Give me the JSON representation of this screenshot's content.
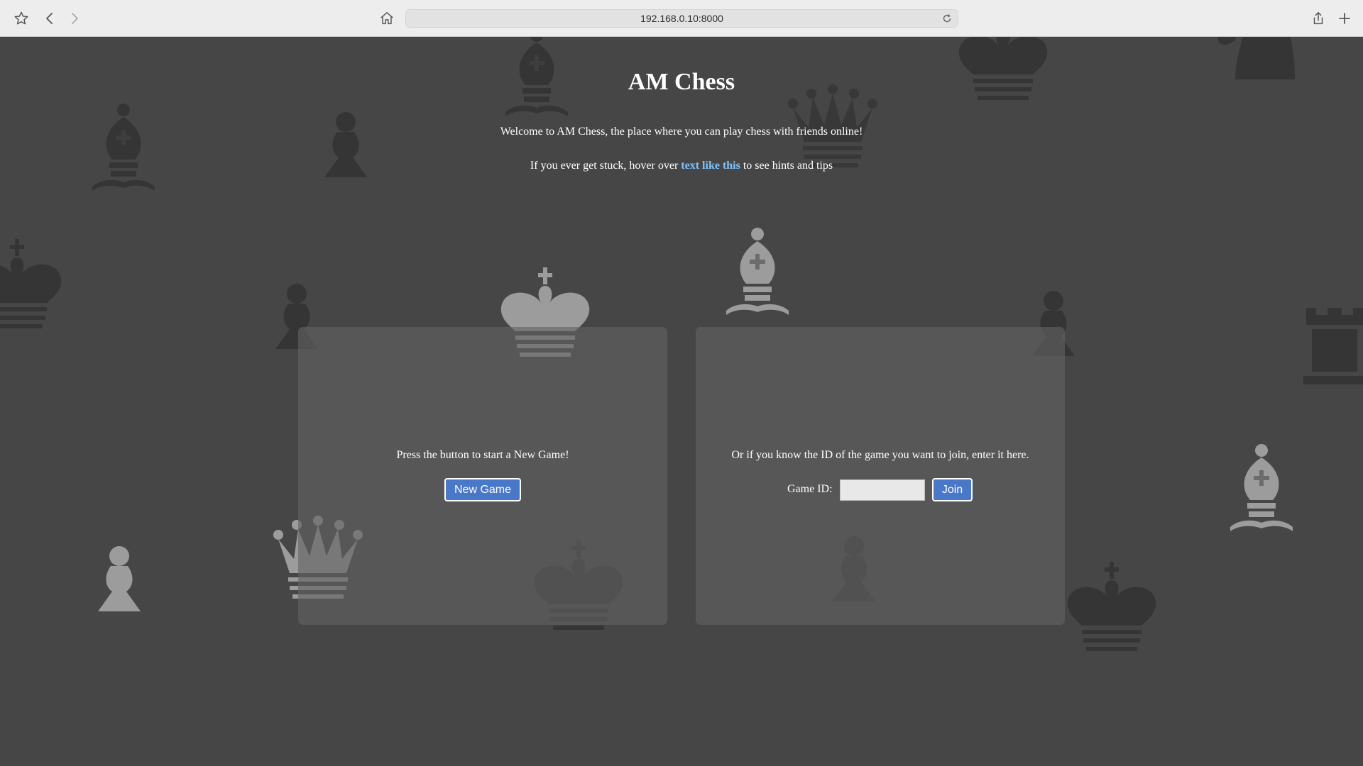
{
  "browser": {
    "url": "192.168.0.10:8000",
    "icons": [
      "bookmark-star-icon",
      "back-icon",
      "forward-icon",
      "home-icon",
      "reload-icon",
      "share-icon",
      "new-tab-icon"
    ]
  },
  "header": {
    "title": "AM Chess",
    "welcome": "Welcome to AM Chess, the place where you can play chess with friends online!",
    "hint_prefix": "If you ever get stuck, hover over ",
    "hint_link": "text like this",
    "hint_suffix": " to see hints and tips"
  },
  "new_game_panel": {
    "text": "Press the button to start a New Game!",
    "button_label": "New Game"
  },
  "join_panel": {
    "text": "Or if you know the ID of the game you want to join, enter it here.",
    "field_label": "Game ID:",
    "field_value": "",
    "field_placeholder": "",
    "button_label": "Join"
  },
  "colors": {
    "page_background": "#464646",
    "panel_background": "#5a5a5a",
    "button_blue": "#4a78c9",
    "link_blue": "#7ec3ff",
    "dark_piece": "#353535",
    "light_piece": "#9a9a9a"
  },
  "background_pieces": [
    "bishop",
    "pawn",
    "bishop",
    "queen",
    "king",
    "knight",
    "king",
    "pawn",
    "king",
    "bishop",
    "pawn",
    "rook",
    "queen",
    "king",
    "pawn",
    "pawn",
    "bishop",
    "king"
  ]
}
